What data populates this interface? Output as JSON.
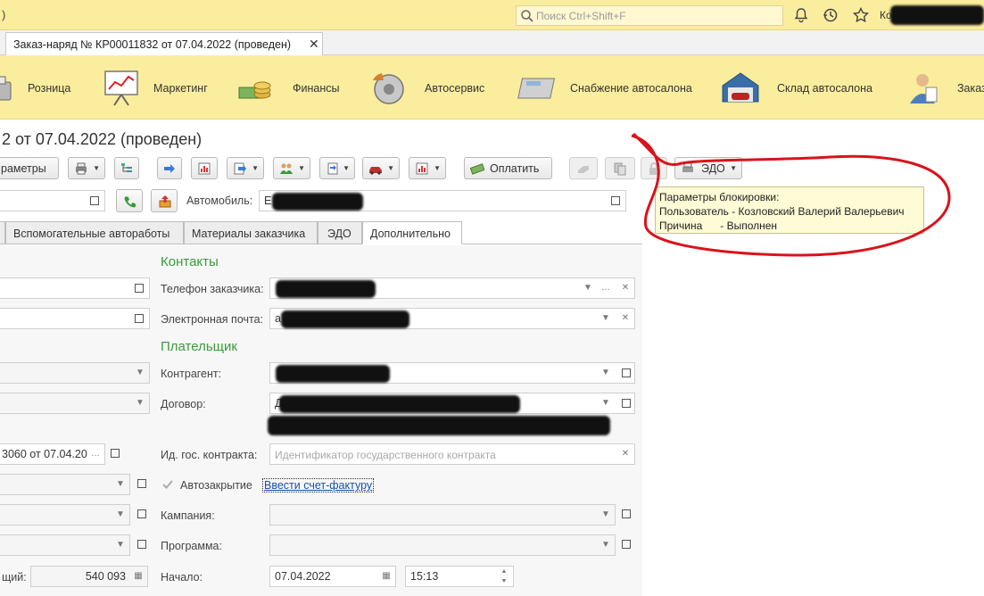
{
  "top": {
    "paren": ")",
    "search_placeholder": "Поиск Ctrl+Shift+F",
    "user_fragment": "Ко"
  },
  "tab": {
    "label": "Заказ-наряд № КР00011832  от 07.04.2022 (проведен)",
    "close": "✕"
  },
  "sections": [
    {
      "label": "Розница"
    },
    {
      "label": "Маркетинг"
    },
    {
      "label": "Финансы"
    },
    {
      "label": "Автосервис"
    },
    {
      "label": "Снабжение автосалона"
    },
    {
      "label": "Склад автосалона"
    },
    {
      "label": "Заказ"
    }
  ],
  "title": "2  от 07.04.2022 (проведен)",
  "toolbar": {
    "params": "раметры",
    "pay": "Оплатить",
    "edo": "ЭДО"
  },
  "tooltip": {
    "line1": "Параметры блокировки:",
    "line2": "Пользователь - Козловский Валерий Валерьевич",
    "line3": "Причина      - Выполнен"
  },
  "fields": {
    "car_label": "Автомобиль:",
    "car_value": "E"
  },
  "form_tabs": [
    {
      "label": "Вспомогательные автоработы"
    },
    {
      "label": "Материалы заказчика"
    },
    {
      "label": "ЭДО"
    },
    {
      "label": "Дополнительно"
    }
  ],
  "contacts": {
    "heading": "Контакты",
    "phone_label": "Телефон заказчика:",
    "email_label": "Электронная почта:",
    "email_value": "a"
  },
  "payer": {
    "heading": "Плательщик",
    "counterparty_label": "Контрагент:",
    "contract_label": "Договор:",
    "contract_value": "Д",
    "gov_label": "Ид. гос. контракта:",
    "gov_placeholder": "Идентификатор государственного контракта",
    "autoclose_label": "Автозакрытие",
    "invoice_link": "Ввести счет-фактуру",
    "campaign_label": "Кампания:",
    "program_label": "Программа:",
    "start_label": "Начало:",
    "start_date": "07.04.2022",
    "start_time": "15:13"
  },
  "left": {
    "doc_ref": "3060 от 07.04.20",
    "total_label": "щий:",
    "total_value": "540 093"
  },
  "colors": {
    "section_bg": "#fbed9e",
    "heading_green": "#3a9a3a",
    "annotation_red": "#d8141c"
  }
}
